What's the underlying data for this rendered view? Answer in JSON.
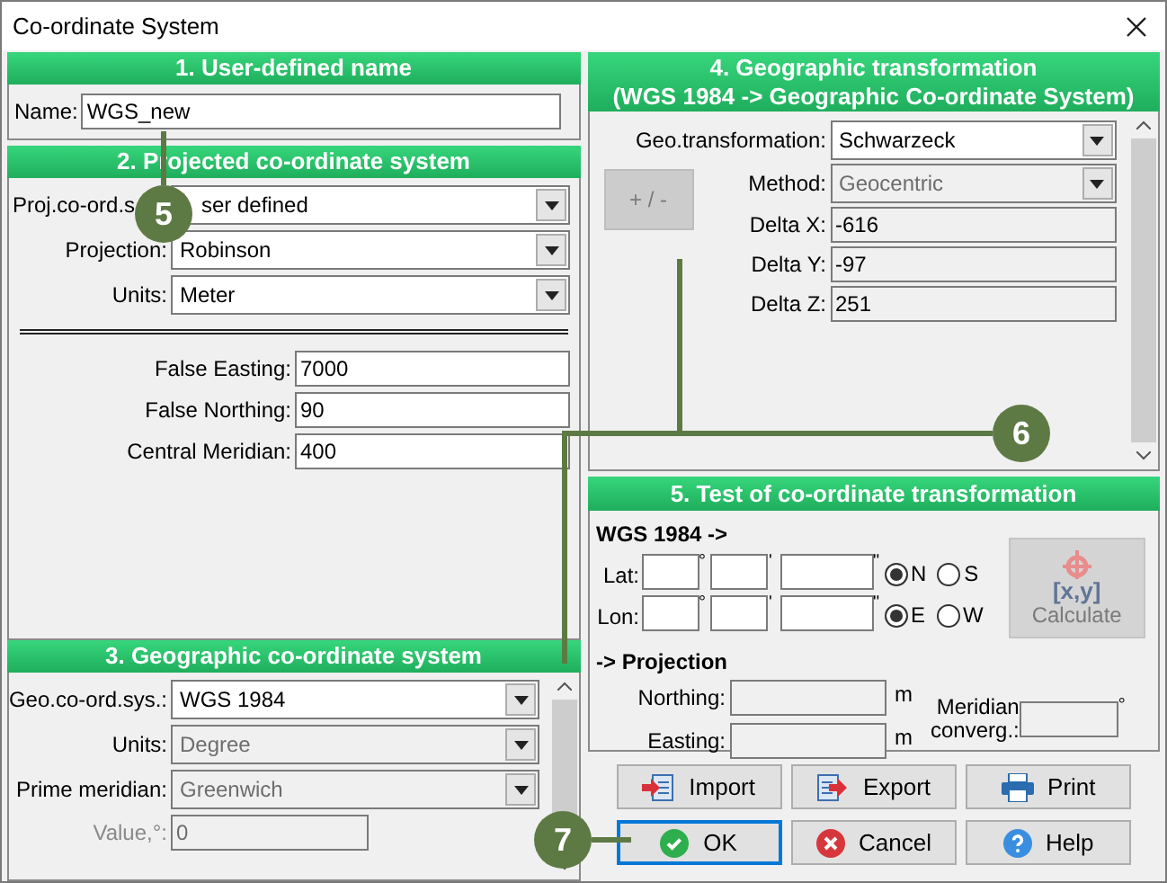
{
  "window": {
    "title": "Co-ordinate System"
  },
  "user_name": {
    "title": "1. User-defined name",
    "label": "Name:",
    "value": "WGS_new"
  },
  "projected": {
    "title": "2. Projected co-ordinate system",
    "selects": [
      {
        "label": "Proj.co-ord.s",
        "value": "ser defined"
      },
      {
        "label": "Projection:",
        "value": "Robinson"
      },
      {
        "label": "Units:",
        "value": "Meter"
      }
    ],
    "fields": [
      {
        "label": "False Easting:",
        "value": "7000"
      },
      {
        "label": "False Northing:",
        "value": "90"
      },
      {
        "label": "Central Meridian:",
        "value": "400"
      }
    ]
  },
  "geographic": {
    "title": "3. Geographic co-ordinate system",
    "rows": [
      {
        "kind": "select",
        "label": "Geo.co-ord.sys.:",
        "value": "WGS 1984",
        "disabled": false
      },
      {
        "kind": "select",
        "label": "Units:",
        "value": "Degree",
        "disabled": true
      },
      {
        "kind": "select",
        "label": "Prime meridian:",
        "value": "Greenwich",
        "disabled": true
      },
      {
        "kind": "input",
        "label": "Value,°:",
        "value": "0",
        "disabled": true
      }
    ]
  },
  "transformation": {
    "title_lines": [
      "4. Geographic transformation",
      "(WGS 1984 -> Geographic Co-ordinate System)"
    ],
    "plus_minus": {
      "label": "+ / -",
      "disabled": true
    },
    "rows": [
      {
        "kind": "select",
        "label": "Geo.transformation:",
        "value": "Schwarzeck",
        "disabled": false
      },
      {
        "kind": "select",
        "label": "Method:",
        "value": "Geocentric",
        "disabled": true
      },
      {
        "kind": "input",
        "label": "Delta X:",
        "value": "-616"
      },
      {
        "kind": "input",
        "label": "Delta Y:",
        "value": "-97"
      },
      {
        "kind": "input",
        "label": "Delta Z:",
        "value": "251"
      }
    ]
  },
  "test": {
    "title": "5. Test of co-ordinate transformation",
    "source_label": "WGS 1984 ->",
    "coords": [
      {
        "label": "Lat:",
        "degree_mark": "°",
        "minute_mark": "'",
        "second_mark": "\"",
        "options": [
          {
            "label": "N",
            "selected": true
          },
          {
            "label": "S",
            "selected": false
          }
        ]
      },
      {
        "label": "Lon:",
        "degree_mark": "°",
        "minute_mark": "'",
        "second_mark": "\"",
        "options": [
          {
            "label": "E",
            "selected": true
          },
          {
            "label": "W",
            "selected": false
          }
        ]
      }
    ],
    "calculate": {
      "icon_text": "[x,y]",
      "label": "Calculate",
      "disabled": true
    },
    "target_label": "-> Projection",
    "outputs": [
      {
        "label": "Northing:",
        "unit": "m"
      },
      {
        "label": "Easting:",
        "unit": "m"
      }
    ],
    "convergence": {
      "label_lines": [
        "Meridian",
        "converg.:"
      ],
      "unit": "°"
    }
  },
  "buttons": [
    {
      "kind": "import",
      "label": "Import",
      "focused": false
    },
    {
      "kind": "export",
      "label": "Export",
      "focused": false
    },
    {
      "kind": "print",
      "label": "Print",
      "focused": false
    },
    {
      "kind": "ok",
      "label": "OK",
      "focused": true
    },
    {
      "kind": "cancel",
      "label": "Cancel",
      "focused": false
    },
    {
      "kind": "help",
      "label": "Help",
      "focused": false
    }
  ],
  "callouts": [
    {
      "number": "5"
    },
    {
      "number": "6"
    },
    {
      "number": "7"
    }
  ]
}
